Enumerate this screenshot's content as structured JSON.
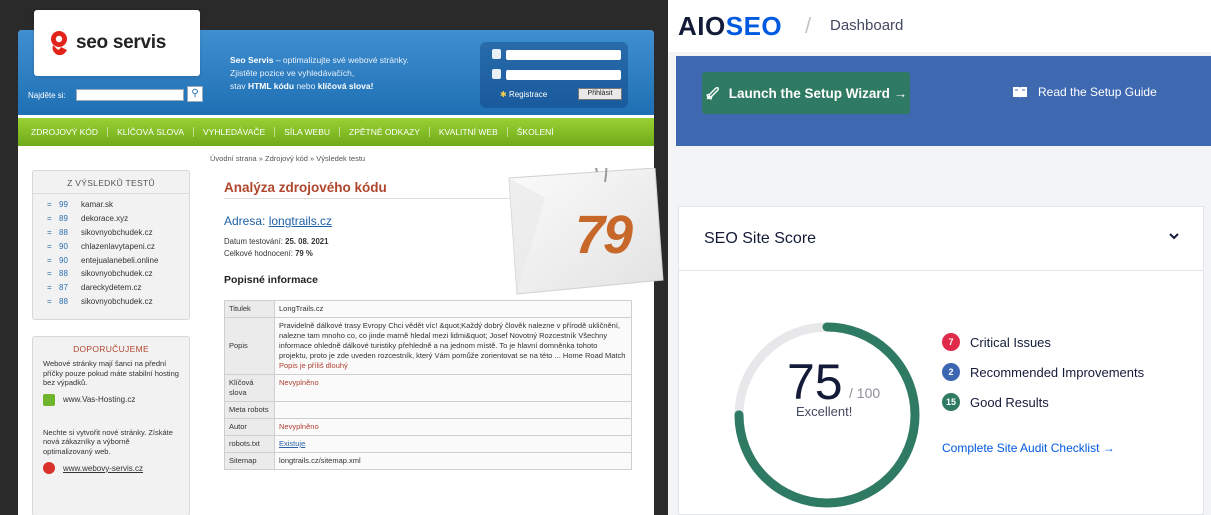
{
  "seo_servis": {
    "logo_text": "seo servis",
    "tagline_1a": "Seo Servis",
    "tagline_1b": " – optimalizujte své webové stránky.",
    "tagline_2": "Zjistěte pozice ve vyhledávačích,",
    "tagline_3a": "stav ",
    "tagline_3b": "HTML kódu",
    "tagline_3c": " nebo ",
    "tagline_3d": "klíčová slova!",
    "search_label": "Najděte si:",
    "register_label": "Registrace",
    "login_button": "Přihlásit",
    "nav": [
      "ZDROJOVÝ KÓD",
      "KLÍČOVÁ SLOVA",
      "VYHLEDÁVAČE",
      "SÍLA WEBU",
      "ZPĚTNÉ ODKAZY",
      "KVALITNÍ WEB",
      "ŠKOLENÍ"
    ],
    "breadcrumb": "Úvodní strana » Zdrojový kód » Výsledek testu",
    "results_title": "Z VÝSLEDKŮ TESTŮ",
    "results": [
      {
        "score": "99",
        "domain": "kamar.sk"
      },
      {
        "score": "89",
        "domain": "dekorace.xyz"
      },
      {
        "score": "88",
        "domain": "sikovnyobchudek.cz"
      },
      {
        "score": "90",
        "domain": "chlazenlavytapeni.cz"
      },
      {
        "score": "90",
        "domain": "entejualanebeli.online"
      },
      {
        "score": "88",
        "domain": "sikovnyobchudek.cz"
      },
      {
        "score": "87",
        "domain": "dareckydetem.cz"
      },
      {
        "score": "88",
        "domain": "sikovnyobchudek.cz"
      }
    ],
    "recommend_title": "DOPORUČUJEME",
    "recommend_text_1": "Webové stránky mají šanci na přední příčky pouze pokud máte stabilní hosting bez výpadků.",
    "recommend_link_1": "www.Vas-Hosting.cz",
    "recommend_text_2": "Nechte si vytvořit nové stránky. Získáte nová zákazníky a výborně optimalizovaný web.",
    "recommend_link_2": "www.webovy-servis.cz",
    "main_title": "Analýza zdrojového kódu",
    "address_label": "Adresa: ",
    "address_url": "longtrails.cz",
    "date_label": "Datum testování: ",
    "date_value": "25. 08. 2021",
    "overall_label": "Celkové hodnocení: ",
    "overall_value": "79 %",
    "desc_title": "Popisné informace",
    "table": {
      "title_key": "Titulek",
      "title_val": "LongTrails.cz",
      "popis_key": "Popis",
      "popis_val": "Pravidelně dálkové trasy Evropy Chci vědět víc! &quot;Každý dobrý člověk nalezne v přírodě ukličnění, nalezne tam mnoho co, co jinde marně hledal mezi lidmi&quot; Josef Novotný Rozcestník Všechny informace ohledně dálkové turistiky přehledně a na jednom místě. To je hlavní domněnka tohoto projektu, proto je zde uveden rozcestník, který Vám pomůže zorientovat se na této ... Home Road Match",
      "popis_note": "Popis je příliš dlouhý",
      "keywords_key": "Klíčová slova",
      "keywords_val": "Nevyplněno",
      "meta_key": "Meta robots",
      "author_key": "Autor",
      "author_val": "Nevyplněno",
      "robots_key": "robots.txt",
      "robots_val": "Existuje",
      "sitemap_key": "Sitemap",
      "sitemap_val": "longtrails.cz/sitemap.xml"
    },
    "sticker_score": "79"
  },
  "aioseo": {
    "logo_aio": "AIO",
    "logo_seo": "SEO",
    "divider": "/",
    "page_title": "Dashboard",
    "wizard_button": "Launch the Setup Wizard →",
    "guide_link": "Read the Setup Guide",
    "card_title": "SEO Site Score",
    "score": "75",
    "score_max": "/ 100",
    "score_label": "Excellent!",
    "score_fraction": 0.75,
    "issues": [
      {
        "count": "7",
        "label": "Critical Issues",
        "color": "#df2a4a"
      },
      {
        "count": "2",
        "label": "Recommended Improvements",
        "color": "#005ae0"
      },
      {
        "count": "15",
        "label": "Good Results",
        "color": "#2f7a62"
      }
    ],
    "audit_link": "Complete Site Audit Checklist →",
    "colors": {
      "hero": "#3e68b0",
      "wizard": "#2f7a62",
      "gauge": "#2f7a62",
      "gauge_track": "#e8e8eb"
    }
  }
}
